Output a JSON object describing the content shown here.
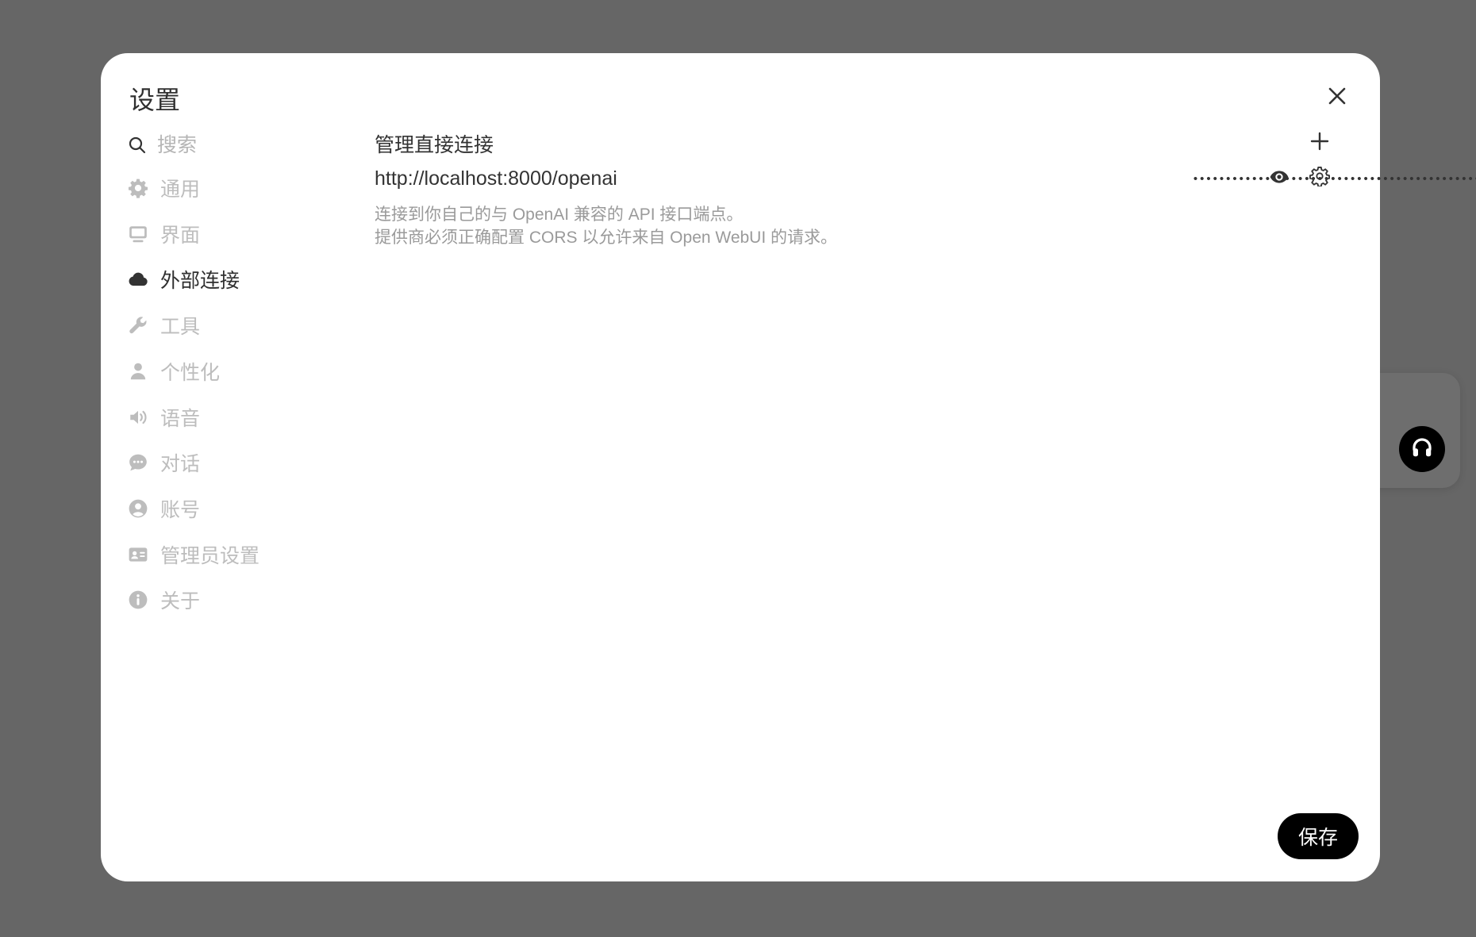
{
  "modal": {
    "title": "设置",
    "save_label": "保存"
  },
  "sidebar": {
    "search_placeholder": "搜索",
    "items": [
      {
        "label": "通用",
        "icon": "gear-icon",
        "active": false
      },
      {
        "label": "界面",
        "icon": "monitor-icon",
        "active": false
      },
      {
        "label": "外部连接",
        "icon": "cloud-icon",
        "active": true
      },
      {
        "label": "工具",
        "icon": "wrench-icon",
        "active": false
      },
      {
        "label": "个性化",
        "icon": "user-icon",
        "active": false
      },
      {
        "label": "语音",
        "icon": "speaker-icon",
        "active": false
      },
      {
        "label": "对话",
        "icon": "chat-bubble-icon",
        "active": false
      },
      {
        "label": "账号",
        "icon": "user-circle-icon",
        "active": false
      },
      {
        "label": "管理员设置",
        "icon": "id-card-icon",
        "active": false
      },
      {
        "label": "关于",
        "icon": "info-icon",
        "active": false
      }
    ]
  },
  "connections": {
    "title": "管理直接连接",
    "items": [
      {
        "url": "http://localhost:8000/openai",
        "key_masked": "••••••••••••••••••••••••••••••••••••••••••••"
      }
    ],
    "help_line1": "连接到你自己的与 OpenAI 兼容的 API 接口端点。",
    "help_line2": "提供商必须正确配置 CORS 以允许来自 Open WebUI 的请求。"
  },
  "colors": {
    "backdrop": "#666666",
    "active_text": "#2f2f2f",
    "inactive_text": "#bdbdbd",
    "primary_button": "#000000"
  }
}
